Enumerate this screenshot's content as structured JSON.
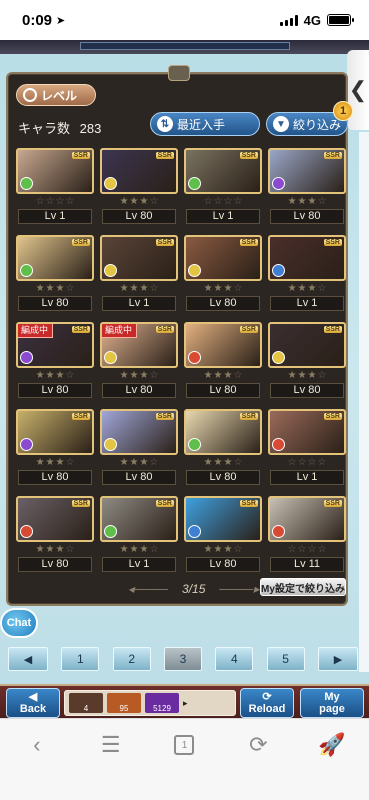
{
  "status_bar": {
    "time": "0:09",
    "network": "4G"
  },
  "panel": {
    "level_label": "レベル",
    "chara_count_label": "キャラ数",
    "chara_count_value": "283",
    "sort_label": "最近入手",
    "filter_label": "絞り込み",
    "filter_badge": "1",
    "page_indicator": "3/15",
    "my_settings_label": "My設定で絞り込み"
  },
  "characters": [
    {
      "level": "Lv 1",
      "stars": 0,
      "rarity": "SSR",
      "element_color": "#5fbf4a",
      "portrait": "#c8a890",
      "tag": ""
    },
    {
      "level": "Lv 80",
      "stars": 3,
      "rarity": "SSR",
      "element_color": "#e3c443",
      "portrait": "#3c3550",
      "tag": ""
    },
    {
      "level": "Lv 1",
      "stars": 0,
      "rarity": "SSR",
      "element_color": "#5fbf4a",
      "portrait": "#7a7260",
      "tag": ""
    },
    {
      "level": "Lv 80",
      "stars": 3,
      "rarity": "SSR",
      "element_color": "#8a4bd1",
      "portrait": "#9aa7c8",
      "tag": ""
    },
    {
      "level": "Lv 80",
      "stars": 3,
      "rarity": "SSR",
      "element_color": "#5fbf4a",
      "portrait": "#e0c48c",
      "tag": ""
    },
    {
      "level": "Lv 1",
      "stars": 3,
      "rarity": "SSR",
      "element_color": "#e3c443",
      "portrait": "#5a4438",
      "tag": ""
    },
    {
      "level": "Lv 80",
      "stars": 3,
      "rarity": "SSR",
      "element_color": "#e3c443",
      "portrait": "#8a5a40",
      "tag": ""
    },
    {
      "level": "Lv 1",
      "stars": 3,
      "rarity": "SSR",
      "element_color": "#3f7fd4",
      "portrait": "#4a2e2a",
      "tag": ""
    },
    {
      "level": "Lv 80",
      "stars": 3,
      "rarity": "SSR",
      "element_color": "#8a4bd1",
      "portrait": "#3a3040",
      "tag": "編成中"
    },
    {
      "level": "Lv 80",
      "stars": 3,
      "rarity": "SSR",
      "element_color": "#e3c443",
      "portrait": "#e0b290",
      "tag": "編成中"
    },
    {
      "level": "Lv 80",
      "stars": 3,
      "rarity": "SSR",
      "element_color": "#d94a32",
      "portrait": "#e2b080",
      "tag": ""
    },
    {
      "level": "Lv 80",
      "stars": 3,
      "rarity": "SSR",
      "element_color": "#e3c443",
      "portrait": "#3a2e30",
      "tag": ""
    },
    {
      "level": "Lv 80",
      "stars": 3,
      "rarity": "SSR",
      "element_color": "#8a4bd1",
      "portrait": "#c7b06a",
      "tag": ""
    },
    {
      "level": "Lv 80",
      "stars": 3,
      "rarity": "SSR",
      "element_color": "#e3c443",
      "portrait": "#a0a6d8",
      "tag": ""
    },
    {
      "level": "Lv 80",
      "stars": 3,
      "rarity": "SSR",
      "element_color": "#5fbf4a",
      "portrait": "#e8d8b0",
      "tag": ""
    },
    {
      "level": "Lv 1",
      "stars": 0,
      "rarity": "SSR",
      "element_color": "#d94a32",
      "portrait": "#9a6a5a",
      "tag": ""
    },
    {
      "level": "Lv 80",
      "stars": 3,
      "rarity": "SSR",
      "element_color": "#d94a32",
      "portrait": "#6a6066",
      "tag": ""
    },
    {
      "level": "Lv 1",
      "stars": 3,
      "rarity": "SSR",
      "element_color": "#5fbf4a",
      "portrait": "#8e8a82",
      "tag": ""
    },
    {
      "level": "Lv 80",
      "stars": 3,
      "rarity": "SSR",
      "element_color": "#3f7fd4",
      "portrait": "#3fa0e0",
      "tag": ""
    },
    {
      "level": "Lv 11",
      "stars": 0,
      "rarity": "SSR",
      "element_color": "#d94a32",
      "portrait": "#c8c0b4",
      "tag": ""
    }
  ],
  "pagination": {
    "prev": "◀",
    "next": "▶",
    "pages": [
      "1",
      "2",
      "3",
      "4",
      "5"
    ],
    "active": "3"
  },
  "chat_label": "Chat",
  "bottom_bar": {
    "back": "Back",
    "reload": "Reload",
    "mypage_line1": "My",
    "mypage_line2": "page",
    "thumb1_text": "4",
    "thumb2_text": "95",
    "thumb3_text": "5129"
  },
  "browser_toolbar": {
    "tabs_count": "1"
  }
}
